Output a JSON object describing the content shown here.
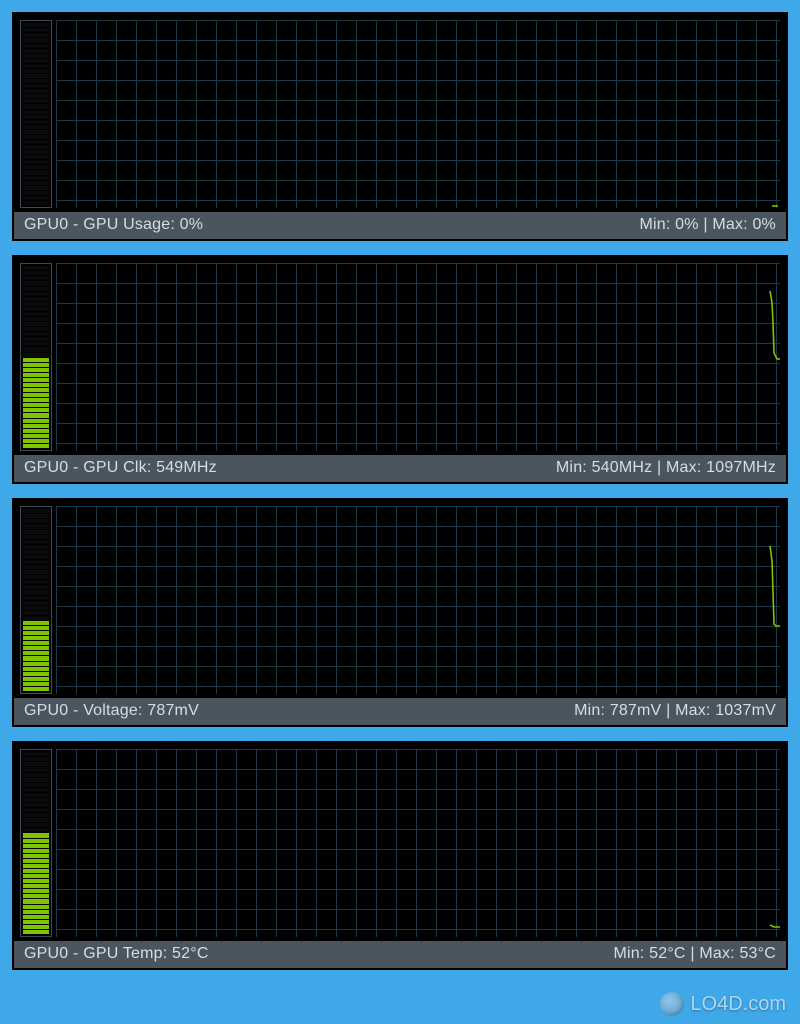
{
  "colors": {
    "page_bg": "#3fa8e8",
    "panel_bg": "#000000",
    "grid_line": "#1c3a45",
    "trace": "#7fc400",
    "status_bg": "#4a5560",
    "status_fg": "#d6dde3"
  },
  "watermark": {
    "text": "LO4D.com"
  },
  "metrics": [
    {
      "id": "gpu-usage",
      "label_left": "GPU0 - GPU Usage: 0%",
      "label_right": "Min: 0% | Max: 0%",
      "bar_fill_pct": 0,
      "trace_points": [
        [
          718,
          186
        ],
        [
          724,
          186
        ]
      ]
    },
    {
      "id": "gpu-clk",
      "label_left": "GPU0 - GPU Clk: 549MHz",
      "label_right": "Min: 540MHz | Max: 1097MHz",
      "bar_fill_pct": 50,
      "trace_points": [
        [
          716,
          28
        ],
        [
          718,
          40
        ],
        [
          719,
          60
        ],
        [
          720,
          90
        ],
        [
          721,
          92
        ],
        [
          722,
          94
        ],
        [
          723,
          96
        ],
        [
          726,
          96
        ]
      ]
    },
    {
      "id": "gpu-voltage",
      "label_left": "GPU0 - Voltage: 787mV",
      "label_right": "Min: 787mV | Max: 1037mV",
      "bar_fill_pct": 40,
      "trace_points": [
        [
          716,
          40
        ],
        [
          718,
          55
        ],
        [
          720,
          118
        ],
        [
          722,
          120
        ],
        [
          724,
          120
        ],
        [
          726,
          120
        ]
      ]
    },
    {
      "id": "gpu-temp",
      "label_left": "GPU0 - GPU Temp: 52°C",
      "label_right": "Min: 52°C | Max: 53°C",
      "bar_fill_pct": 55,
      "trace_points": [
        [
          716,
          176
        ],
        [
          720,
          178
        ],
        [
          724,
          178
        ],
        [
          726,
          178
        ]
      ]
    }
  ],
  "chart_data": [
    {
      "type": "line",
      "title": "GPU0 - GPU Usage",
      "unit": "%",
      "current": 0,
      "min": 0,
      "max": 0,
      "y_range_hint": [
        0,
        100
      ],
      "series": [
        {
          "name": "usage",
          "y": [
            0,
            0
          ]
        }
      ]
    },
    {
      "type": "line",
      "title": "GPU0 - GPU Clk",
      "unit": "MHz",
      "current": 549,
      "min": 540,
      "max": 1097,
      "y_range_hint": [
        0,
        1097
      ],
      "series": [
        {
          "name": "clk",
          "y": [
            1097,
            900,
            700,
            560,
            549,
            549,
            549,
            549
          ]
        }
      ]
    },
    {
      "type": "line",
      "title": "GPU0 - Voltage",
      "unit": "mV",
      "current": 787,
      "min": 787,
      "max": 1037,
      "y_range_hint": [
        0,
        1037
      ],
      "series": [
        {
          "name": "mv",
          "y": [
            1037,
            950,
            790,
            787,
            787,
            787
          ]
        }
      ]
    },
    {
      "type": "line",
      "title": "GPU0 - GPU Temp",
      "unit": "°C",
      "current": 52,
      "min": 52,
      "max": 53,
      "y_range_hint": [
        0,
        100
      ],
      "series": [
        {
          "name": "temp",
          "y": [
            53,
            52,
            52,
            52
          ]
        }
      ]
    }
  ]
}
